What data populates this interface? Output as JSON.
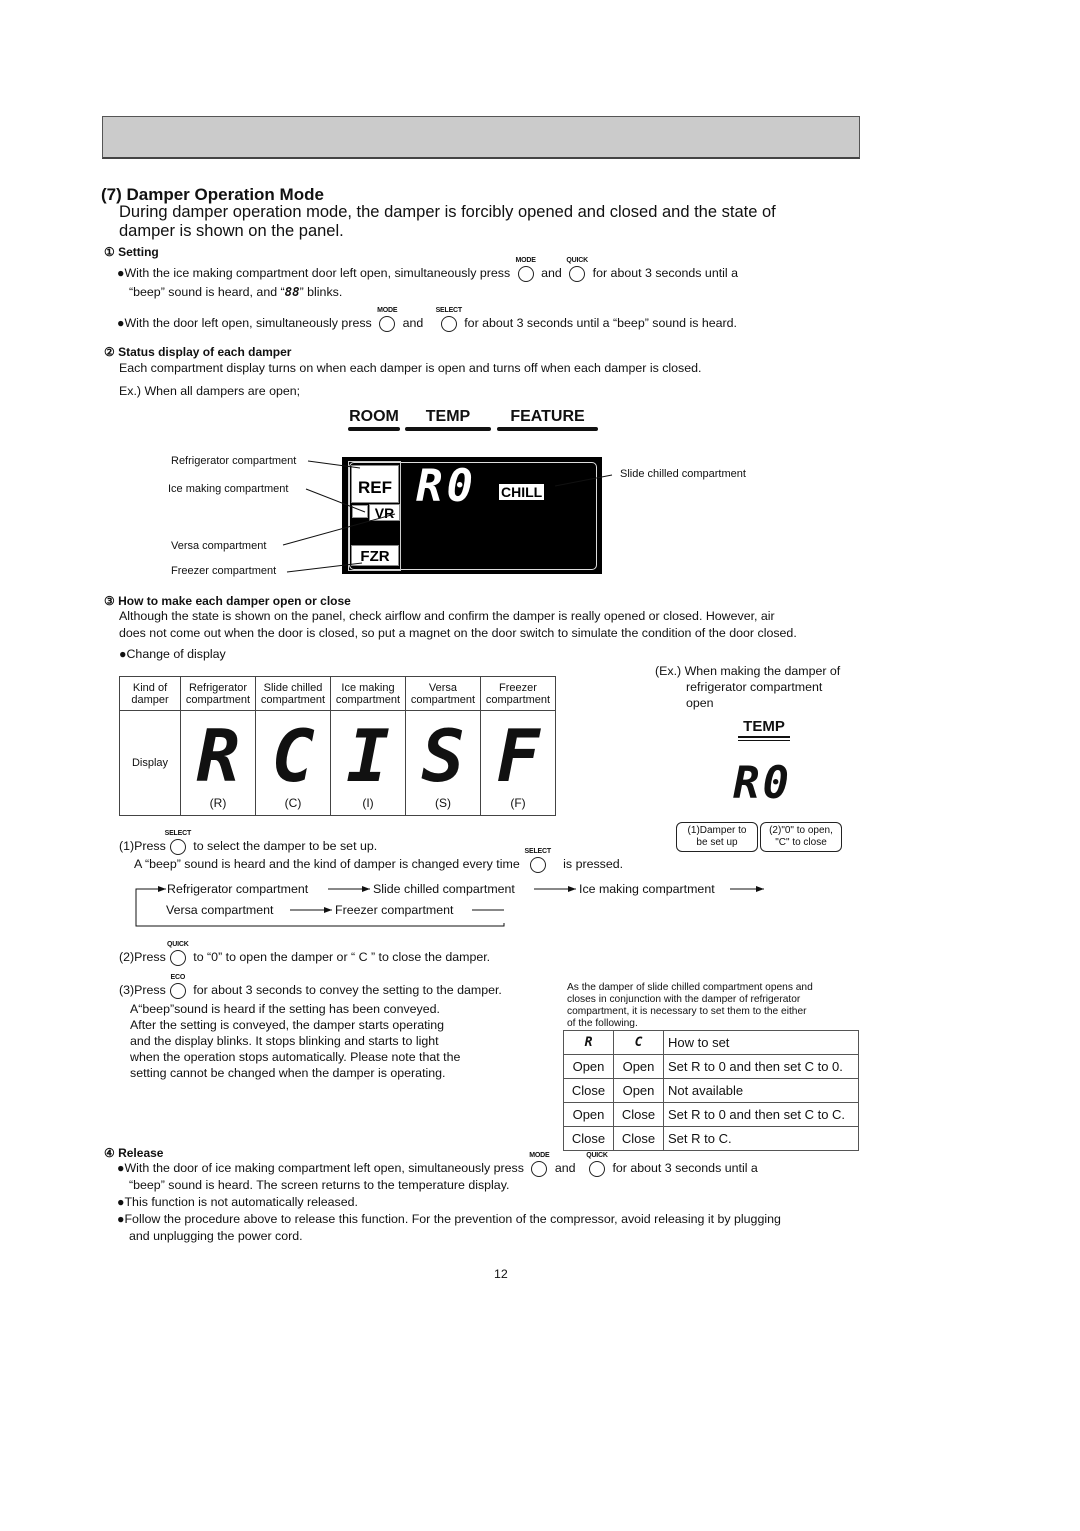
{
  "header_bar": "",
  "section": {
    "title": "(7) Damper Operation Mode",
    "intro_line1": "During damper operation mode, the damper is forcibly opened and closed and the state of",
    "intro_line2": "damper is shown on the panel."
  },
  "setting": {
    "heading": "① Setting",
    "bullet1_a": "●With the ice making compartment door left open, simultaneously press",
    "bullet1_and": "and",
    "bullet1_b": "for about 3 seconds until a",
    "bullet1_c": "“beep” sound is heard, and “",
    "bullet1_code": "88",
    "bullet1_d": "” blinks.",
    "bullet2_a": "●With the door left open, simultaneously press",
    "bullet2_and": "and",
    "bullet2_b": "for about 3 seconds until a “beep” sound is heard.",
    "btn_mode": "MODE",
    "btn_quick": "QUICK",
    "btn_select": "SELECT",
    "btn_eco": "ECO"
  },
  "status": {
    "heading": "② Status display of each damper",
    "text": "Each compartment display turns on when each damper is open and turns off when each damper is closed.",
    "example": "Ex.) When all dampers are open;"
  },
  "panel": {
    "tabs": [
      "ROOM",
      "TEMP",
      "FEATURE"
    ],
    "ref": "REF",
    "vr": "VR",
    "fzr": "FZR",
    "digits": "R0",
    "chill": "CHILL",
    "callouts": {
      "refrigerator": "Refrigerator compartment",
      "ice": "Ice making compartment",
      "versa": "Versa compartment",
      "freezer": "Freezer compartment",
      "slide": "Slide chilled compartment"
    }
  },
  "how_to": {
    "heading": "③ How to make each damper open or close",
    "text1": "Although the state is shown on the panel, check airflow and confirm the damper is really opened or closed. However, air",
    "text2": "does not come out when the door is closed, so put a magnet on the door switch to simulate the condition of the door closed.",
    "change": "●Change of display"
  },
  "damper_table": {
    "header_label_1": "Kind of",
    "header_label_2": "damper",
    "row_label": "Display",
    "columns": [
      {
        "l1": "Refrigerator",
        "l2": "compartment",
        "glyph": "R",
        "code": "(R)"
      },
      {
        "l1": "Slide chilled",
        "l2": "compartment",
        "glyph": "C",
        "code": "(C)"
      },
      {
        "l1": "Ice making",
        "l2": "compartment",
        "glyph": "I",
        "code": "(I)"
      },
      {
        "l1": "Versa",
        "l2": "compartment",
        "glyph": "S",
        "code": "(S)"
      },
      {
        "l1": "Freezer",
        "l2": "compartment",
        "glyph": "F",
        "code": "(F)"
      }
    ]
  },
  "example": {
    "line1": "(Ex.) When making the damper of",
    "line2": "refrigerator compartment",
    "line3": "open",
    "tab": "TEMP",
    "digits": "R0",
    "bubble1_l1": "(1)Damper to",
    "bubble1_l2": "be set up",
    "bubble2_l1": "(2)\"0\" to open,",
    "bubble2_l2": "\"C\" to close"
  },
  "steps": {
    "s1_a": "(1)Press",
    "s1_b": "to select the damper to be set up.",
    "s1_c": "A “beep” sound is heard and the kind of damper is changed every time",
    "s1_d": "is pressed.",
    "cycle": [
      "Refrigerator compartment",
      "Slide chilled compartment",
      "Ice making compartment",
      "Versa compartment",
      "Freezer compartment"
    ],
    "s2_a": "(2)Press",
    "s2_b": "to “0” to open the damper or “ C ” to close the damper.",
    "s3_a": "(3)Press",
    "s3_b": "for about 3 seconds to convey the setting to the damper.",
    "s3_lines": [
      "A“beep”sound is heard if the setting has been conveyed.",
      "After the setting is conveyed, the damper starts operating",
      "and the display blinks. It stops blinking and starts to light",
      "when the operation stops automatically. Please note that the",
      "setting cannot be changed when the damper is operating."
    ]
  },
  "note": {
    "lines": [
      "As the damper of slide chilled compartment opens and",
      "closes in conjunction  with the damper of refrigerator",
      "compartment, it is necessary to set them to the either",
      "of the following."
    ],
    "table": {
      "headers": [
        "R",
        "C",
        "How to set"
      ],
      "rows": [
        [
          "Open",
          "Open",
          "Set R to 0 and then set C to 0."
        ],
        [
          "Close",
          "Open",
          "Not available"
        ],
        [
          "Open",
          "Close",
          "Set R to 0 and then set C to C."
        ],
        [
          "Close",
          "Close",
          "Set R to C."
        ]
      ]
    }
  },
  "release": {
    "heading": "④ Release",
    "b1_a": "●With the door of ice making compartment left open, simultaneously press",
    "b1_and": "and",
    "b1_b": "for about 3 seconds until a",
    "b1_c": "“beep” sound is heard. The screen returns to the temperature display.",
    "b2": "●This function is not automatically released.",
    "b3_a": "●Follow the procedure above to release this function. For the prevention of the compressor, avoid releasing it by plugging",
    "b3_b": "and unplugging the power cord."
  },
  "page_number": "12"
}
